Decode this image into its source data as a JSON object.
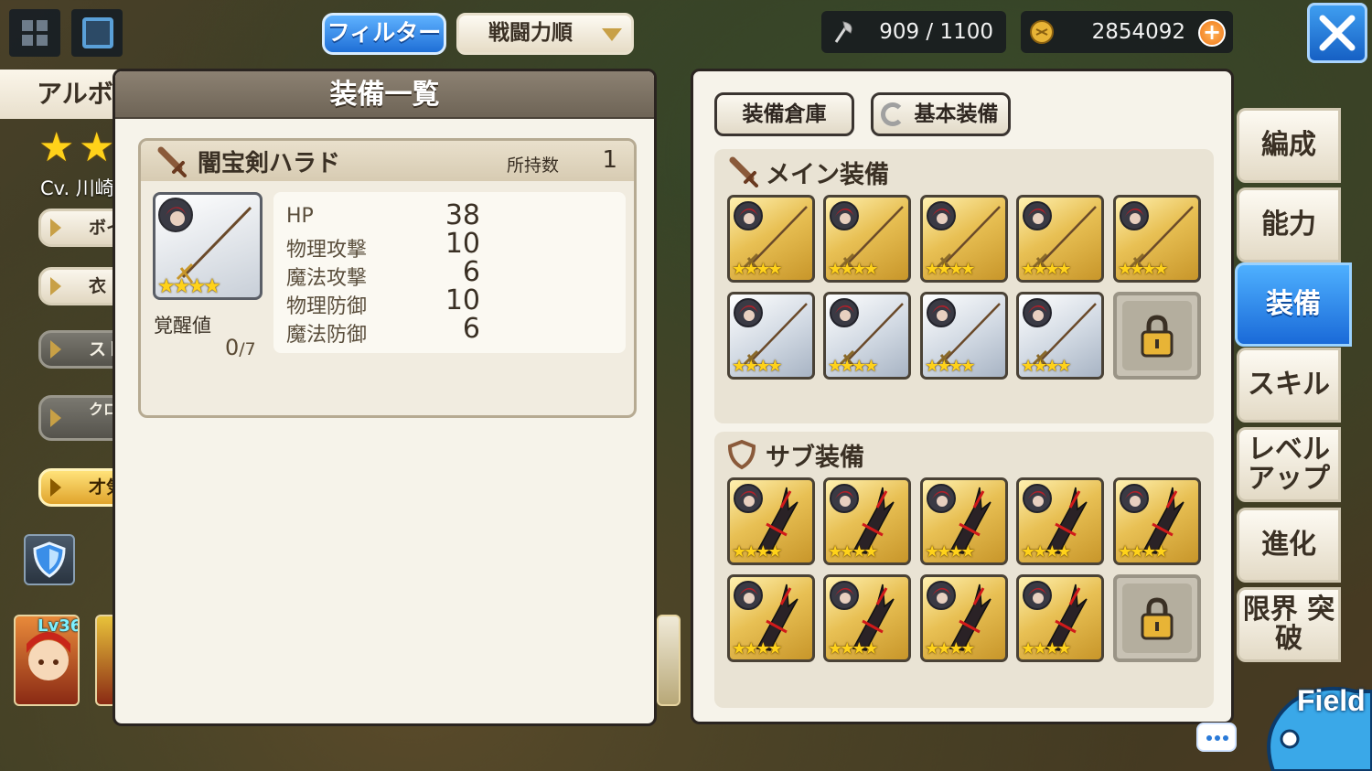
{
  "topbar": {
    "filter_label": "フィルター",
    "sort_label": "戦闘力順",
    "stamina_value": "909 / 1100",
    "gold_value": "2854092",
    "plus_label": "+"
  },
  "left_bg": {
    "character_name": "アルボ",
    "cv_text": "Cv. 川崎",
    "pills": [
      "ボイ",
      "衣",
      "スト",
      "クロス ストー",
      "才気"
    ],
    "portrait_level": "Lv36"
  },
  "equip_list": {
    "title": "装備一覧",
    "item_name": "闇宝剣ハラド",
    "owned_label": "所持数",
    "owned_count": "1",
    "awaken_label": "覚醒値",
    "awaken_current": "0",
    "awaken_max": "/7",
    "rarity_stars": "★★★★",
    "stats": [
      {
        "label": "HP",
        "value": "38"
      },
      {
        "label": "物理攻撃",
        "value": "10"
      },
      {
        "label": "魔法攻撃",
        "value": "6"
      },
      {
        "label": "物理防御",
        "value": "10"
      },
      {
        "label": "魔法防御",
        "value": "6"
      }
    ]
  },
  "slots_panel": {
    "storage_label": "装備倉庫",
    "basic_label": "基本装備",
    "main_title": "メイン装備",
    "sub_title": "サブ装備",
    "slot_stars": "★★★★"
  },
  "side_tabs": [
    "編成",
    "能力",
    "装備",
    "スキル",
    "レベル アップ",
    "進化",
    "限界 突破"
  ],
  "field_label": "Field",
  "colors": {
    "accent_blue": "#1f6fd6",
    "gold_frame": "#e8c054",
    "panel_bg": "#f6f3ea",
    "star": "#ffd21a"
  }
}
